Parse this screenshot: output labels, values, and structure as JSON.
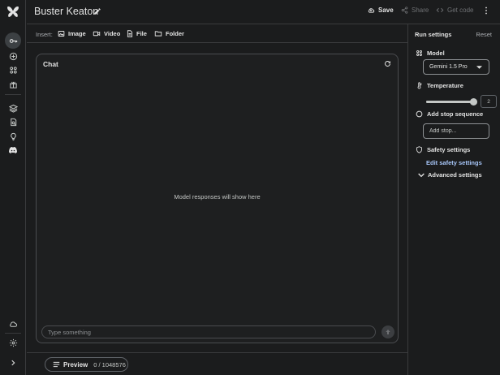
{
  "app": {
    "title": "Buster Keaton"
  },
  "toolbar": {
    "save_label": "Save",
    "share_label": "Share",
    "get_code_label": "Get code"
  },
  "insert": {
    "label": "Insert:",
    "items": [
      {
        "label": "Image",
        "icon": "image-icon"
      },
      {
        "label": "Video",
        "icon": "video-icon"
      },
      {
        "label": "File",
        "icon": "file-icon"
      },
      {
        "label": "Folder",
        "icon": "folder-icon"
      }
    ]
  },
  "chat": {
    "title": "Chat",
    "empty_text": "Model responses will show here",
    "input_placeholder": "Type something"
  },
  "bottom": {
    "preview_label": "Preview",
    "token_count": "0 / 1048576"
  },
  "settings": {
    "title": "Run settings",
    "reset_label": "Reset",
    "model_label": "Model",
    "model_value": "Gemini 1.5 Pro",
    "temperature_label": "Temperature",
    "temperature_value": "2",
    "temperature_fraction": 1.0,
    "stop_label": "Add stop sequence",
    "stop_placeholder": "Add stop...",
    "safety_label": "Safety settings",
    "edit_safety_label": "Edit safety settings",
    "advanced_label": "Advanced settings"
  },
  "colors": {
    "background": "#1b1c1d",
    "panel_border": "#3a3b3d",
    "text": "#e3e3e3",
    "link": "#a8c7fa",
    "muted": "#6f7174"
  }
}
